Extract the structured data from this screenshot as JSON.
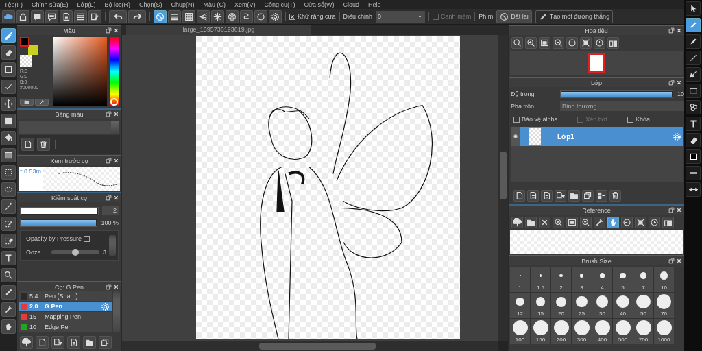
{
  "menu": [
    "Tệp(F)",
    "Chỉnh sửa(E)",
    "Lớp(L)",
    "Bộ lọc(R)",
    "Chọn(S)",
    "Chụp(N)",
    "Màu (C)",
    "Xem(V)",
    "Công cụ(T)",
    "Cửa sổ(W)",
    "Cloud",
    "Help"
  ],
  "toolbar": {
    "file_buttons": [
      {
        "kind": "cloud"
      },
      {
        "kind": "export"
      },
      {
        "kind": "bubble"
      },
      {
        "kind": "caption"
      },
      {
        "kind": "page"
      },
      {
        "kind": "pagelist"
      },
      {
        "kind": "pageedit"
      }
    ],
    "history_buttons": [
      {
        "kind": "undo"
      },
      {
        "kind": "redo"
      }
    ],
    "ruler_buttons": [
      {
        "kind": "noruler",
        "selected": true
      },
      {
        "kind": "parallel",
        "selected": false
      },
      {
        "kind": "grid",
        "selected": false
      },
      {
        "kind": "perspective",
        "selected": false
      },
      {
        "kind": "radial",
        "selected": false
      },
      {
        "kind": "concentric",
        "selected": false
      },
      {
        "kind": "curve",
        "selected": false
      },
      {
        "kind": "ellipse",
        "selected": false
      },
      {
        "kind": "gear",
        "selected": false
      }
    ],
    "antialias": {
      "label": "Khử răng cưa",
      "checked": true
    },
    "adjust": {
      "label": "Điều chỉnh",
      "value": "0"
    },
    "soft_edge": {
      "label": "Canh mềm",
      "checked": false,
      "disabled": true
    },
    "key_label": "Phím",
    "reset_button": "Đặt lại",
    "line_button": "Tạo một đường thẳng"
  },
  "left_tools": [
    {
      "kind": "brush",
      "selected": true
    },
    {
      "kind": "eraser",
      "selected": false
    },
    {
      "kind": "square",
      "selected": false
    },
    {
      "kind": "tick",
      "selected": false
    },
    {
      "kind": "move",
      "selected": false
    },
    {
      "kind": "block",
      "selected": false
    },
    {
      "kind": "bucket",
      "selected": false
    },
    {
      "kind": "gradient",
      "selected": false
    },
    {
      "kind": "marquee",
      "selected": false
    },
    {
      "kind": "lasso",
      "selected": false
    },
    {
      "kind": "wand",
      "selected": false
    },
    {
      "kind": "selpen",
      "selected": false
    },
    {
      "kind": "selerase",
      "selected": false
    },
    {
      "kind": "text",
      "selected": false
    },
    {
      "kind": "operation",
      "selected": false
    },
    {
      "kind": "pen",
      "selected": false
    },
    {
      "kind": "dropper",
      "selected": false
    },
    {
      "kind": "hand",
      "selected": false
    }
  ],
  "right_tools": [
    {
      "kind": "cursor",
      "selected": false
    },
    {
      "kind": "pencil",
      "selected": true
    },
    {
      "kind": "marker",
      "selected": false
    },
    {
      "kind": "line",
      "selected": false
    },
    {
      "kind": "arrow",
      "selected": false
    },
    {
      "kind": "rect",
      "selected": false
    },
    {
      "kind": "circles",
      "selected": false
    },
    {
      "kind": "text",
      "selected": false
    },
    {
      "kind": "eraser",
      "selected": false
    },
    {
      "kind": "swatch",
      "selected": false
    },
    {
      "kind": "minus",
      "selected": false
    },
    {
      "kind": "swap",
      "selected": false
    }
  ],
  "color_panel": {
    "title": "Màu",
    "hue": {
      "level": 0
    },
    "rgb": [
      "R:0",
      "G:0",
      "B:0"
    ],
    "hex": "#000000"
  },
  "palette_panel": {
    "title": "Bảng màu",
    "palette_name": "---"
  },
  "preview_panel": {
    "title": "Xem trước cọ",
    "size": "* 0.53m"
  },
  "brush_control": {
    "title": "Kiểm soát cọ",
    "size": {
      "level": 1,
      "value": "2"
    },
    "opacity": {
      "level": 1,
      "value": "100 %"
    },
    "pressure": {
      "label": "Opacity by Pressure",
      "checked": false
    },
    "ooze": {
      "label": "Ooze",
      "level": 0.5,
      "value": "3"
    }
  },
  "brush_panel": {
    "title": "Cọ: G Pen",
    "brushes": [
      {
        "color": "#2a2a2a",
        "size": "5.4",
        "name": "Pen (Sharp)",
        "selected": false
      },
      {
        "color": "#e83a3a",
        "size": "2.0",
        "name": "G Pen",
        "selected": true
      },
      {
        "color": "#e83a3a",
        "size": "15",
        "name": "Mapping Pen",
        "selected": false
      },
      {
        "color": "#1fa81f",
        "size": "10",
        "name": "Edge Pen",
        "selected": false
      }
    ],
    "buttons": [
      {
        "kind": "upload"
      },
      {
        "kind": "doc"
      },
      {
        "kind": "docmenu"
      },
      {
        "kind": "docs"
      },
      {
        "kind": "folder"
      },
      {
        "kind": "copy"
      }
    ]
  },
  "canvas": {
    "tab": "large_1595736193619.jpg"
  },
  "navigator": {
    "title": "Hoa tiêu",
    "tools": [
      {
        "kind": "zoom"
      },
      {
        "kind": "zoomin"
      },
      {
        "kind": "fit"
      },
      {
        "kind": "zoomout"
      },
      {
        "kind": "rotl"
      },
      {
        "kind": "fitrot"
      },
      {
        "kind": "rotr"
      },
      {
        "kind": "flip"
      }
    ]
  },
  "layers": {
    "title": "Lớp",
    "opacity_label": "Độ trong",
    "opacity": {
      "level": 1,
      "value": "10"
    },
    "blend_label": "Pha trộn",
    "blend": "Bình thường",
    "options": [
      {
        "label": "Bảo vệ alpha",
        "checked": false,
        "disabled": false
      },
      {
        "label": "Xén bớt",
        "checked": false,
        "disabled": true
      },
      {
        "label": "Khóa",
        "checked": false,
        "disabled": false
      }
    ],
    "items": [
      {
        "name": "Lớp1",
        "selected": true,
        "visible": true
      }
    ],
    "buttons": [
      {
        "kind": "doc"
      },
      {
        "kind": "docs"
      },
      {
        "kind": "docs"
      },
      {
        "kind": "docmenu"
      },
      {
        "kind": "folder"
      },
      {
        "kind": "copy"
      },
      {
        "kind": "merge"
      },
      {
        "kind": "trash"
      }
    ]
  },
  "reference": {
    "title": "Reference",
    "tools": [
      {
        "kind": "upload",
        "selected": false
      },
      {
        "kind": "folder",
        "selected": false
      },
      {
        "kind": "close",
        "selected": false
      },
      {
        "kind": "zoomin",
        "selected": false
      },
      {
        "kind": "fit",
        "selected": false
      },
      {
        "kind": "zoomout",
        "selected": false
      },
      {
        "kind": "dropper",
        "selected": false
      },
      {
        "kind": "hand",
        "selected": true
      },
      {
        "kind": "rotl",
        "selected": false
      },
      {
        "kind": "fitrot",
        "selected": false
      },
      {
        "kind": "rotr",
        "selected": false
      },
      {
        "kind": "flip",
        "selected": false
      }
    ]
  },
  "brush_size": {
    "title": "Brush Size",
    "sizes": [
      "1",
      "1.5",
      "2",
      "3",
      "4",
      "5",
      "7",
      "10",
      "12",
      "15",
      "20",
      "25",
      "30",
      "40",
      "50",
      "70",
      "100",
      "150",
      "200",
      "300",
      "400",
      "500",
      "700",
      "1000"
    ]
  }
}
